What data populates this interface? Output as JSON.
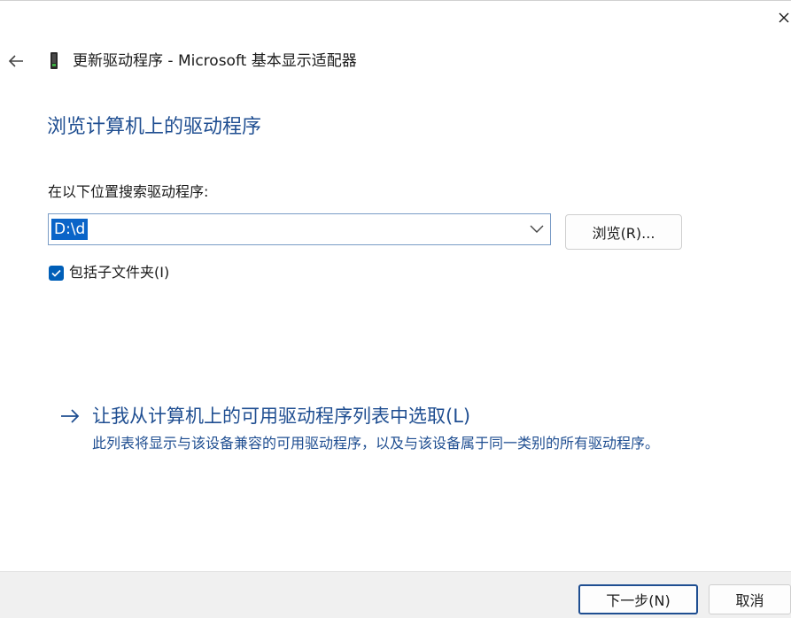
{
  "window": {
    "title": "更新驱动程序 - Microsoft 基本显示适配器",
    "close_icon": "close-icon",
    "back_icon": "arrow-left-icon",
    "device_icon": "display-adapter-icon"
  },
  "page": {
    "title": "浏览计算机上的驱动程序"
  },
  "search": {
    "label": "在以下位置搜索驱动程序:",
    "path_value": "D:\\d",
    "browse_label": "浏览(R)...",
    "include_subfolders_label": "包括子文件夹(I)",
    "include_subfolders_checked": true
  },
  "pick_option": {
    "title": "让我从计算机上的可用驱动程序列表中选取(L)",
    "description": "此列表将显示与该设备兼容的可用驱动程序，以及与该设备属于同一类别的所有驱动程序。"
  },
  "footer": {
    "next_label": "下一步(N)",
    "cancel_label": "取消"
  },
  "colors": {
    "accent": "#1f4e91",
    "selection": "#0a64c8",
    "checkbox": "#005fb8",
    "footer_bg": "#f0f0f0"
  }
}
